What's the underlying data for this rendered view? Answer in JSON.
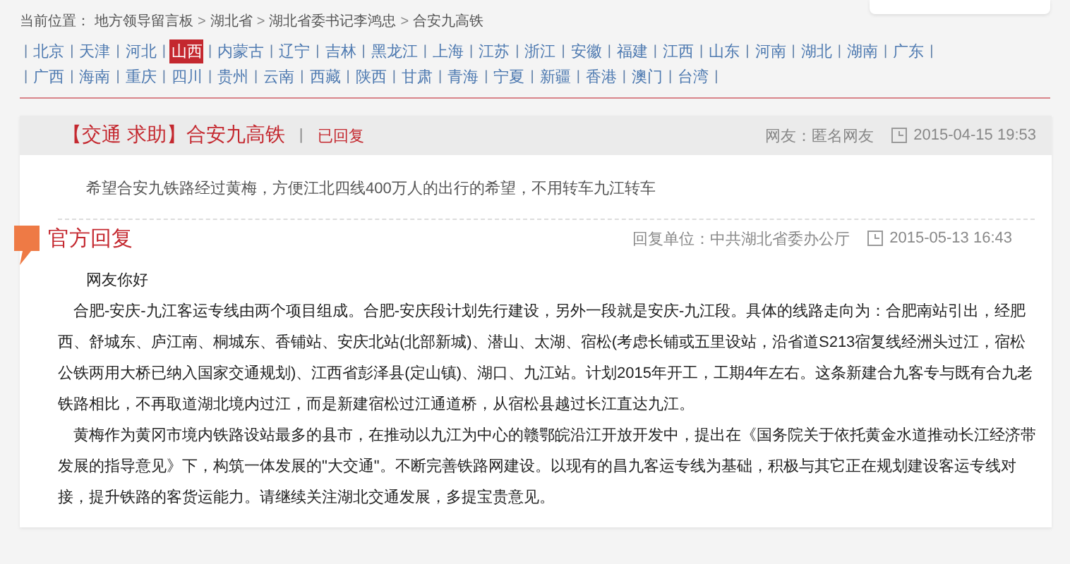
{
  "breadcrumb": {
    "label": "当前位置：",
    "separator": ">",
    "items": [
      "地方领导留言板",
      "湖北省",
      "湖北省委书记李鸿忠",
      "合安九高铁"
    ]
  },
  "region_nav": {
    "separator": "|",
    "rows": [
      [
        {
          "label": "北京",
          "selected": false
        },
        {
          "label": "天津",
          "selected": false
        },
        {
          "label": "河北",
          "selected": false
        },
        {
          "label": "山西",
          "selected": true
        },
        {
          "label": "内蒙古",
          "selected": false
        },
        {
          "label": "辽宁",
          "selected": false
        },
        {
          "label": "吉林",
          "selected": false
        },
        {
          "label": "黑龙江",
          "selected": false
        },
        {
          "label": "上海",
          "selected": false
        },
        {
          "label": "江苏",
          "selected": false
        },
        {
          "label": "浙江",
          "selected": false
        },
        {
          "label": "安徽",
          "selected": false
        },
        {
          "label": "福建",
          "selected": false
        },
        {
          "label": "江西",
          "selected": false
        },
        {
          "label": "山东",
          "selected": false
        },
        {
          "label": "河南",
          "selected": false
        },
        {
          "label": "湖北",
          "selected": false
        },
        {
          "label": "湖南",
          "selected": false
        },
        {
          "label": "广东",
          "selected": false
        }
      ],
      [
        {
          "label": "广西",
          "selected": false
        },
        {
          "label": "海南",
          "selected": false
        },
        {
          "label": "重庆",
          "selected": false
        },
        {
          "label": "四川",
          "selected": false
        },
        {
          "label": "贵州",
          "selected": false
        },
        {
          "label": "云南",
          "selected": false
        },
        {
          "label": "西藏",
          "selected": false
        },
        {
          "label": "陕西",
          "selected": false
        },
        {
          "label": "甘肃",
          "selected": false
        },
        {
          "label": "青海",
          "selected": false
        },
        {
          "label": "宁夏",
          "selected": false
        },
        {
          "label": "新疆",
          "selected": false
        },
        {
          "label": "香港",
          "selected": false
        },
        {
          "label": "澳门",
          "selected": false
        },
        {
          "label": "台湾",
          "selected": false
        }
      ]
    ]
  },
  "question": {
    "title": "【交通 求助】合安九高铁",
    "separator": "|",
    "status": "已回复",
    "author": "网友：匿名网友",
    "time": "2015-04-15 19:53",
    "body": "希望合安九铁路经过黄梅，方便江北四线400万人的出行的希望，不用转车九江转车"
  },
  "reply": {
    "title": "官方回复",
    "unit": "回复单位：中共湖北省委办公厅",
    "time": "2015-05-13 16:43",
    "greeting": "网友你好",
    "paragraphs": [
      "合肥-安庆-九江客运专线由两个项目组成。合肥-安庆段计划先行建设，另外一段就是安庆-九江段。具体的线路走向为：合肥南站引出，经肥西、舒城东、庐江南、桐城东、香铺站、安庆北站(北部新城)、潜山、太湖、宿松(考虑长铺或五里设站，沿省道S213宿复线经洲头过江，宿松公铁两用大桥已纳入国家交通规划)、江西省彭泽县(定山镇)、湖口、九江站。计划2015年开工，工期4年左右。这条新建合九客专与既有合九老铁路相比，不再取道湖北境内过江，而是新建宿松过江通道桥，从宿松县越过长江直达九江。",
      "黄梅作为黄冈市境内铁路设站最多的县市，在推动以九江为中心的赣鄂皖沿江开放开发中，提出在《国务院关于依托黄金水道推动长江经济带发展的指导意见》下，构筑一体发展的\"大交通\"。不断完善铁路网建设。以现有的昌九客运专线为基础，积极与其它正在规划建设客运专线对接，提升铁路的客货运能力。请继续关注湖北交通发展，多提宝贵意见。"
    ]
  }
}
